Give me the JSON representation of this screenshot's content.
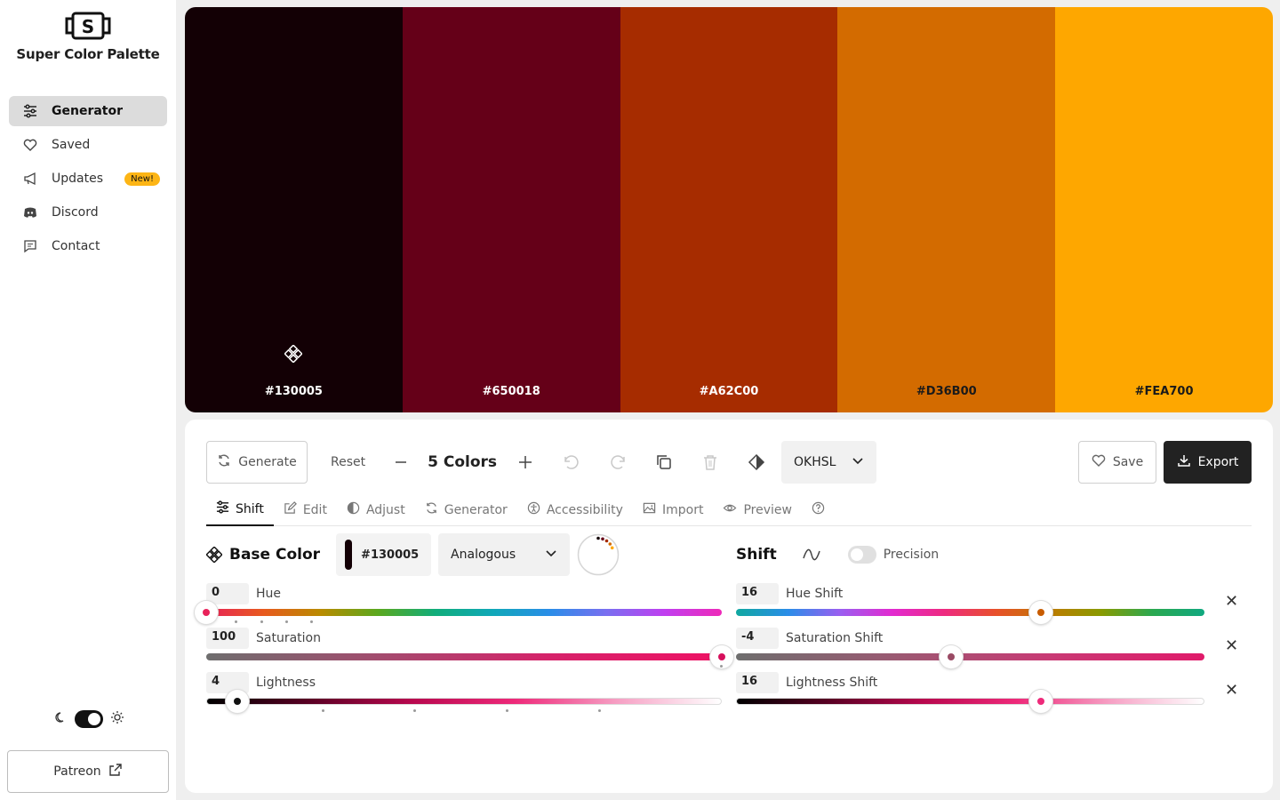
{
  "app": {
    "title": "Super Color Palette"
  },
  "sidebar": {
    "items": [
      {
        "label": "Generator",
        "icon": "sliders-icon",
        "active": true
      },
      {
        "label": "Saved",
        "icon": "heart-icon"
      },
      {
        "label": "Updates",
        "icon": "megaphone-icon",
        "badge": "New!"
      },
      {
        "label": "Discord",
        "icon": "discord-icon"
      },
      {
        "label": "Contact",
        "icon": "message-icon"
      }
    ],
    "patreon_label": "Patreon"
  },
  "palette": {
    "swatches": [
      {
        "hex": "#130005",
        "text_color": "#ffffff"
      },
      {
        "hex": "#650018",
        "text_color": "#ffffff"
      },
      {
        "hex": "#A62C00",
        "text_color": "#ffffff"
      },
      {
        "hex": "#D36B00",
        "text_color": "#1a1a1a"
      },
      {
        "hex": "#FEA700",
        "text_color": "#1a1a1a"
      }
    ]
  },
  "toolbar": {
    "generate_label": "Generate",
    "reset_label": "Reset",
    "count_label": "5 Colors",
    "color_space": "OKHSL",
    "save_label": "Save",
    "export_label": "Export"
  },
  "tabs": [
    {
      "label": "Shift",
      "icon": "sliders-icon",
      "active": true
    },
    {
      "label": "Edit",
      "icon": "edit-icon"
    },
    {
      "label": "Adjust",
      "icon": "contrast-icon"
    },
    {
      "label": "Generator",
      "icon": "refresh-icon"
    },
    {
      "label": "Accessibility",
      "icon": "accessibility-icon"
    },
    {
      "label": "Import",
      "icon": "image-icon"
    },
    {
      "label": "Preview",
      "icon": "eye-icon"
    },
    {
      "label": "",
      "icon": "help-icon"
    }
  ],
  "base": {
    "title": "Base Color",
    "hex": "#130005",
    "harmony": "Analogous",
    "sliders": [
      {
        "label": "Hue",
        "value": "0",
        "level": 0.0
      },
      {
        "label": "Saturation",
        "value": "100",
        "level": 1.0
      },
      {
        "label": "Lightness",
        "value": "4",
        "level": 0.04
      }
    ]
  },
  "shift": {
    "title": "Shift",
    "precision_label": "Precision",
    "sliders": [
      {
        "label": "Hue Shift",
        "value": "16"
      },
      {
        "label": "Saturation Shift",
        "value": "-4"
      },
      {
        "label": "Lightness Shift",
        "value": "16"
      }
    ]
  }
}
